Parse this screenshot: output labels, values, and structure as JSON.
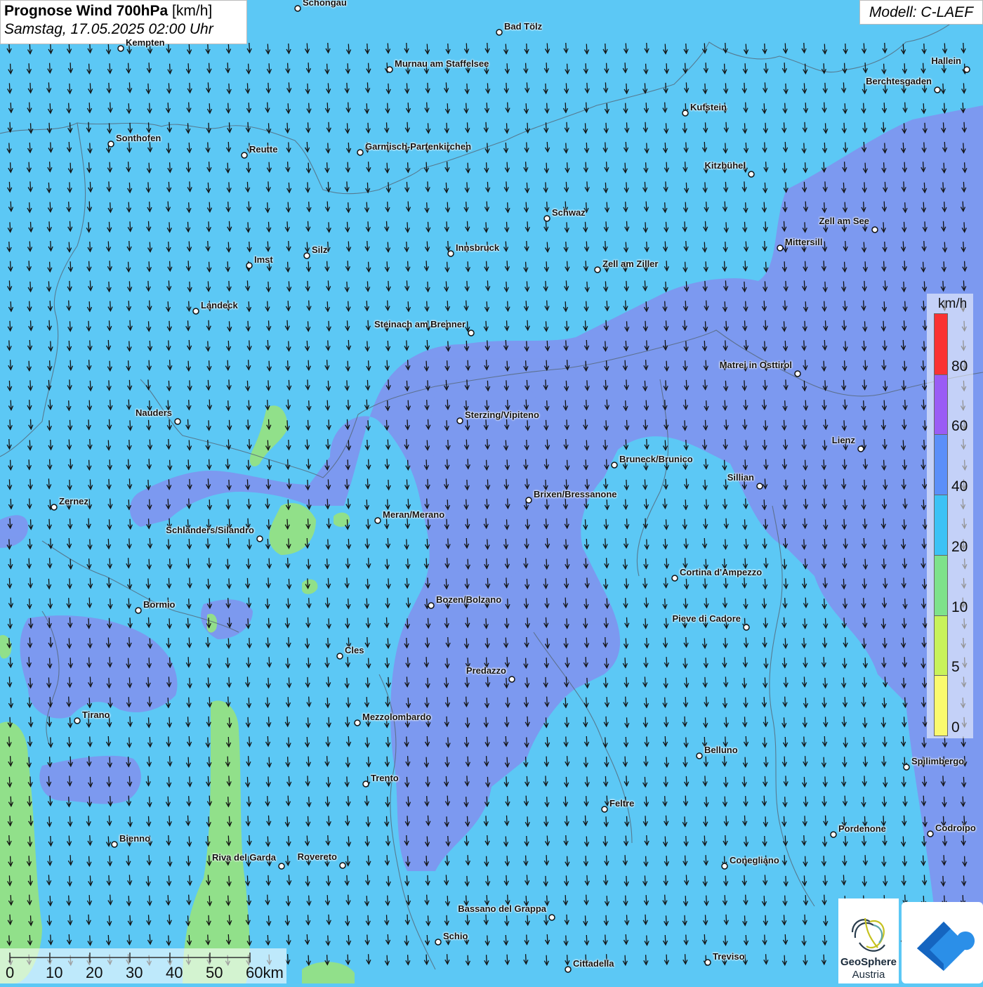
{
  "header": {
    "title_bold": "Prognose Wind 700hPa",
    "title_unit": "[km/h]",
    "datetime": "Samstag, 17.05.2025 02:00 Uhr",
    "model": "Modell: C-LAEF"
  },
  "legend": {
    "unit": "km/h",
    "levels": [
      {
        "label": "80",
        "color": "#fa3232"
      },
      {
        "label": "60",
        "color": "#9a5cf5"
      },
      {
        "label": "40",
        "color": "#5b8ff9"
      },
      {
        "label": "20",
        "color": "#3cc2f5"
      },
      {
        "label": "10",
        "color": "#7ee28b"
      },
      {
        "label": "5",
        "color": "#c8f25a"
      },
      {
        "label": "0",
        "color": "#fafa6e"
      }
    ]
  },
  "colors": {
    "background": "#5cc8f5",
    "strong_wind": "#8094ef",
    "weak_wind": "#94e284",
    "border": "#556677"
  },
  "wind_direction": "north",
  "scale_bar": {
    "labels": [
      "0",
      "10",
      "20",
      "30",
      "40",
      "50",
      "60km"
    ]
  },
  "cities": [
    {
      "name": "Schongau"
    },
    {
      "name": "Bad Tölz"
    },
    {
      "name": "Kempten"
    },
    {
      "name": "Murnau am Staffelsee"
    },
    {
      "name": "Hallein"
    },
    {
      "name": "Berchtesgaden"
    },
    {
      "name": "Kufstein"
    },
    {
      "name": "Sonthofen"
    },
    {
      "name": "Reutte"
    },
    {
      "name": "Garmisch-Partenkirchen"
    },
    {
      "name": "Kitzbühel"
    },
    {
      "name": "Schwaz"
    },
    {
      "name": "Zell am See"
    },
    {
      "name": "Mittersill"
    },
    {
      "name": "Innsbruck"
    },
    {
      "name": "Silz"
    },
    {
      "name": "Imst"
    },
    {
      "name": "Zell am Ziller"
    },
    {
      "name": "Landeck"
    },
    {
      "name": "Steinach am Brenner"
    },
    {
      "name": "Matrei in Osttirol"
    },
    {
      "name": "Nauders"
    },
    {
      "name": "Sterzing/Vipiteno"
    },
    {
      "name": "Lienz"
    },
    {
      "name": "Bruneck/Brunico"
    },
    {
      "name": "Sillian"
    },
    {
      "name": "Zernez"
    },
    {
      "name": "Brixen/Bressanone"
    },
    {
      "name": "Meran/Merano"
    },
    {
      "name": "Schlanders/Silandro"
    },
    {
      "name": "Cortina d'Ampezzo"
    },
    {
      "name": "Bozen/Bolzano"
    },
    {
      "name": "Bormio"
    },
    {
      "name": "Pieve di Cadore"
    },
    {
      "name": "Cles"
    },
    {
      "name": "Predazzo"
    },
    {
      "name": "Tirano"
    },
    {
      "name": "Mezzolombardo"
    },
    {
      "name": "Belluno"
    },
    {
      "name": "Spilimbergo"
    },
    {
      "name": "Trento"
    },
    {
      "name": "Feltre"
    },
    {
      "name": "Pordenone"
    },
    {
      "name": "Codroipo"
    },
    {
      "name": "Bienno"
    },
    {
      "name": "Riva del Garda"
    },
    {
      "name": "Rovereto"
    },
    {
      "name": "Conegliano"
    },
    {
      "name": "Bassano del Grappa"
    },
    {
      "name": "Schio"
    },
    {
      "name": "Treviso"
    },
    {
      "name": "Cittadella"
    }
  ],
  "logo": {
    "name": "GeoSphere",
    "sub": "Austria"
  }
}
